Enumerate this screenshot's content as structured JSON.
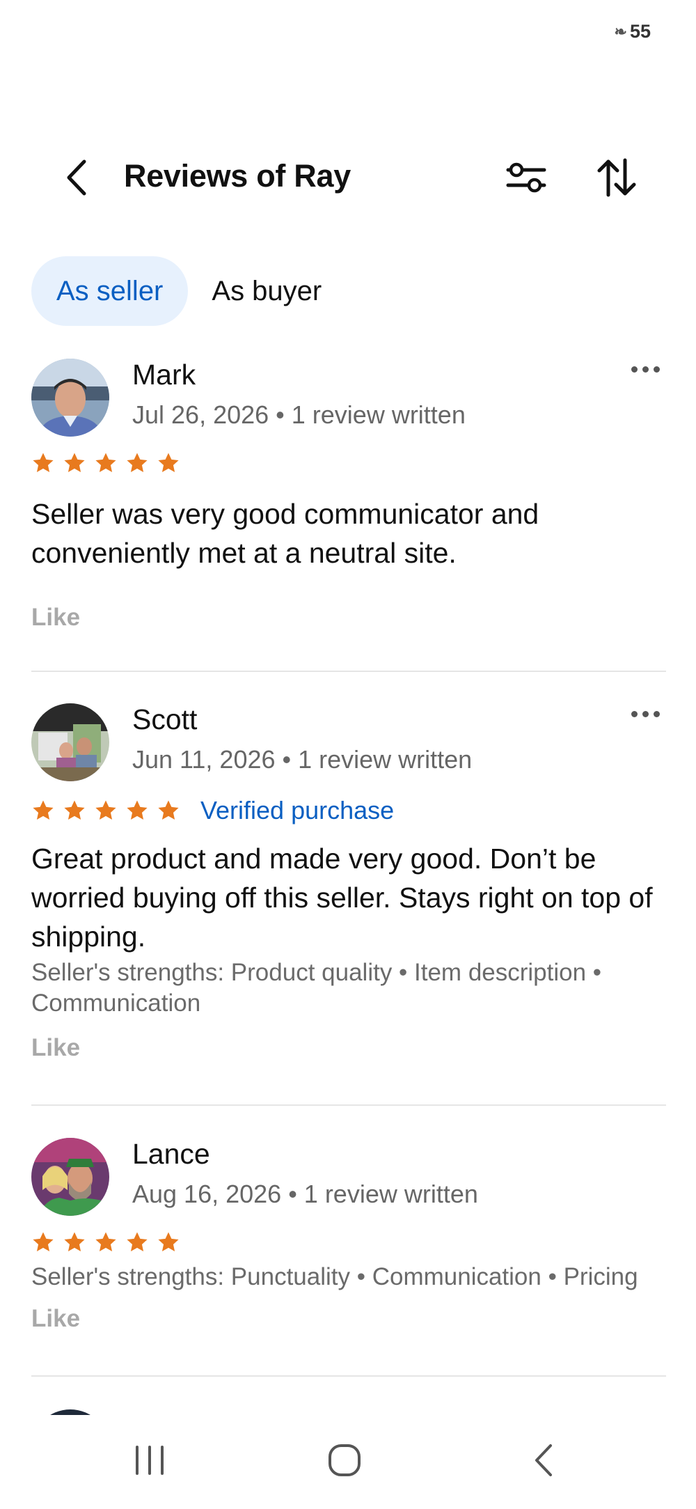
{
  "status_bar": {
    "battery": "55"
  },
  "header": {
    "title": "Reviews of Ray"
  },
  "tabs": [
    {
      "label": "As seller",
      "active": true
    },
    {
      "label": "As buyer",
      "active": false
    }
  ],
  "reviews": [
    {
      "name": "Mark",
      "date": "Jul 26, 2026",
      "written": "1 review written",
      "meta": "Jul 26, 2026 • 1 review written",
      "stars": 5,
      "verified": "",
      "text": "Seller was very good communicator and conveniently met at a neutral site.",
      "strengths": "",
      "like": "Like"
    },
    {
      "name": "Scott",
      "date": "Jun 11, 2026",
      "written": "1 review written",
      "meta": "Jun 11, 2026 • 1 review written",
      "stars": 5,
      "verified": "Verified purchase",
      "text": "Great product and made very good. Don’t be worried buying off this seller. Stays right on top of shipping.",
      "strengths": "Seller's strengths: Product quality • Item description • Communication",
      "like": "Like"
    },
    {
      "name": "Lance",
      "date": "Aug 16, 2026",
      "written": "1 review written",
      "meta": "Aug 16, 2026 • 1 review written",
      "stars": 5,
      "verified": "",
      "text": "",
      "strengths": "Seller's strengths: Punctuality • Communication • Pricing",
      "like": "Like"
    }
  ],
  "colors": {
    "accent": "#0a5fc2",
    "star": "#e87a1e",
    "tab_active_bg": "#e7f1fd"
  },
  "icons": [
    "back-arrow-icon",
    "filter-sliders-icon",
    "sort-arrows-icon",
    "more-options-icon",
    "star-icon",
    "recent-apps-icon",
    "home-icon",
    "nav-back-icon"
  ]
}
